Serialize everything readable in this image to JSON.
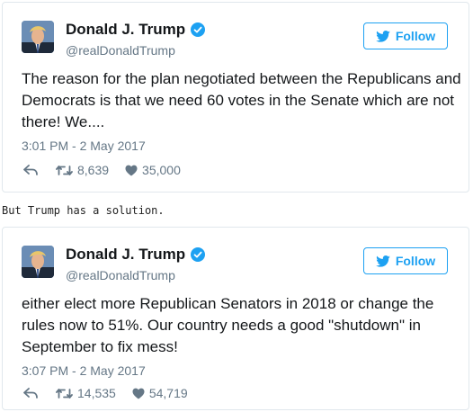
{
  "tweets": [
    {
      "display_name": "Donald J. Trump",
      "handle": "@realDonaldTrump",
      "follow_label": "Follow",
      "text": "The reason for the plan negotiated between the Republicans and Democrats is that we need 60 votes in the Senate which are not there! We....",
      "timestamp": "3:01 PM - 2 May 2017",
      "retweets": "8,639",
      "likes": "35,000"
    },
    {
      "display_name": "Donald J. Trump",
      "handle": "@realDonaldTrump",
      "follow_label": "Follow",
      "text": "either elect more Republican Senators in 2018 or change the rules now to 51%. Our country needs a good \"shutdown\" in September to fix mess!",
      "timestamp": "3:07 PM - 2 May 2017",
      "retweets": "14,535",
      "likes": "54,719"
    }
  ],
  "caption": "But Trump has a solution.",
  "icons": {
    "verified": "verified-badge-icon",
    "follow": "twitter-bird-icon",
    "reply": "reply-arrow-icon",
    "retweet": "retweet-icon",
    "like": "heart-icon"
  },
  "colors": {
    "accent": "#1da1f2",
    "text": "#14171a",
    "muted": "#657786",
    "border": "#e1e8ed"
  }
}
